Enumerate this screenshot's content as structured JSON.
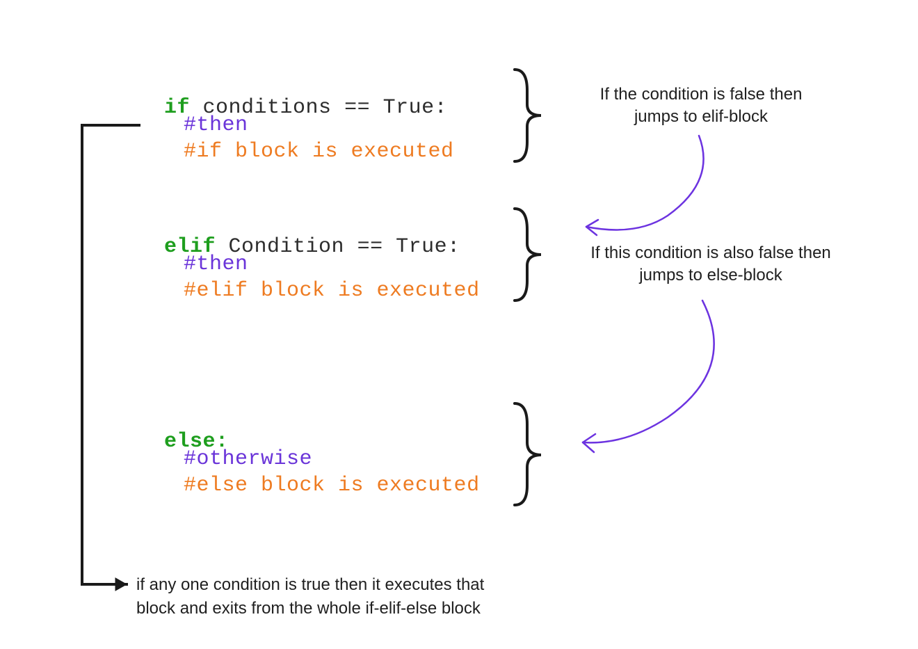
{
  "code": {
    "if_keyword": "if",
    "if_condition": " conditions == True:",
    "if_comment1": "#then",
    "if_comment2": "#if block is executed",
    "elif_keyword": "elif",
    "elif_condition": " Condition == True:",
    "elif_comment1": "#then",
    "elif_comment2": "#elif block is executed",
    "else_keyword": "else:",
    "else_comment1": "#otherwise",
    "else_comment2": "#else block is executed"
  },
  "annotations": {
    "if_note": "If the condition is false then\njumps to elif-block",
    "elif_note": "If this condition is also false then\njumps to else-block",
    "bottom_note": "if any one condition is true then it executes that\nblock and exits from the whole if-elif-else block"
  }
}
